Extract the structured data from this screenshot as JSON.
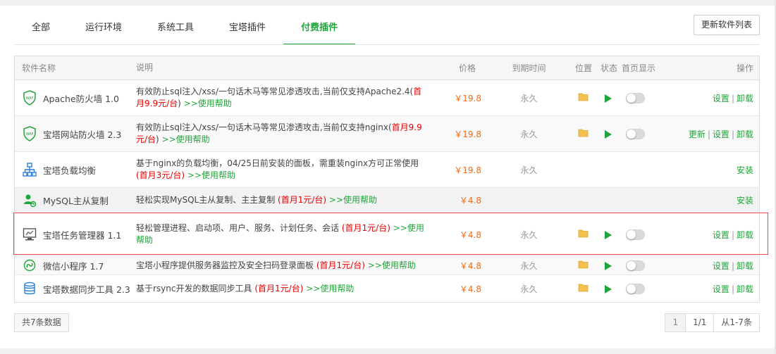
{
  "tabs": [
    {
      "label": "全部"
    },
    {
      "label": "运行环境"
    },
    {
      "label": "系统工具"
    },
    {
      "label": "宝塔插件"
    },
    {
      "label": "付费插件"
    }
  ],
  "refresh_label": "更新软件列表",
  "columns": {
    "name": "软件名称",
    "desc": "说明",
    "price": "价格",
    "expire": "到期时间",
    "pos": "位置",
    "status": "状态",
    "home": "首页显示",
    "op": "操作"
  },
  "rows": [
    {
      "name": "Apache防火墙 1.0",
      "desc": "有效防止sql注入/xss/一句话木马等常见渗透攻击,当前仅支持Apache2.4(",
      "desc_red": "首月9.9元/台",
      "desc_tail": ")",
      "help": ">>使用帮助",
      "price": "￥19.8",
      "expire": "永久",
      "ops": [
        "设置",
        "卸载"
      ]
    },
    {
      "name": "宝塔网站防火墙 2.3",
      "desc": "有效防止sql注入/xss/一句话木马等常见渗透攻击,当前仅支持nginx(",
      "desc_red": "首月9.9元/台",
      "desc_tail": ")",
      "help": ">>使用帮助",
      "price": "￥19.8",
      "expire": "永久",
      "ops": [
        "更新",
        "设置",
        "卸载"
      ]
    },
    {
      "name": "宝塔负载均衡",
      "desc": "基于nginx的负载均衡，04/25日前安装的面板，需重装nginx方可正常使用",
      "desc_red": "(首月3元/台)",
      "desc_tail": "",
      "help": ">>使用帮助",
      "price": "￥19.8",
      "expire": "永久",
      "ops": [
        "安装"
      ]
    },
    {
      "name": "MySQL主从复制",
      "desc": "轻松实现MySQL主从复制、主主复制",
      "desc_red": "(首月1元/台)",
      "desc_tail": "",
      "help": ">>使用帮助",
      "price": "￥4.8",
      "expire": "",
      "ops": [
        "安装"
      ]
    },
    {
      "name": "宝塔任务管理器 1.1",
      "desc": "轻松管理进程、启动项、用户、服务、计划任务、会话",
      "desc_red": "(首月1元/台)",
      "desc_tail": "",
      "help": ">>使用帮助",
      "price": "￥4.8",
      "expire": "永久",
      "ops": [
        "设置",
        "卸载"
      ]
    },
    {
      "name": "微信小程序 1.7",
      "desc": "宝塔小程序提供服务器监控及安全扫码登录面板",
      "desc_red": "(首月1元/台)",
      "desc_tail": "",
      "help": ">>使用帮助",
      "price": "￥4.8",
      "expire": "永久",
      "ops": [
        "设置",
        "卸载"
      ]
    },
    {
      "name": "宝塔数据同步工具 2.3",
      "desc": "基于rsync开发的数据同步工具",
      "desc_red": "(首月1元/台)",
      "desc_tail": "",
      "help": ">>使用帮助",
      "price": "￥4.8",
      "expire": "永久",
      "ops": [
        "设置",
        "卸载"
      ]
    }
  ],
  "footer": {
    "count": "共7条数据",
    "pages": [
      "1",
      "1/1",
      "从1-7条"
    ]
  },
  "colors": {
    "accent": "#20a53a",
    "price": "#f6680b",
    "promo": "#e60000",
    "highlight": "#e54b4b"
  }
}
